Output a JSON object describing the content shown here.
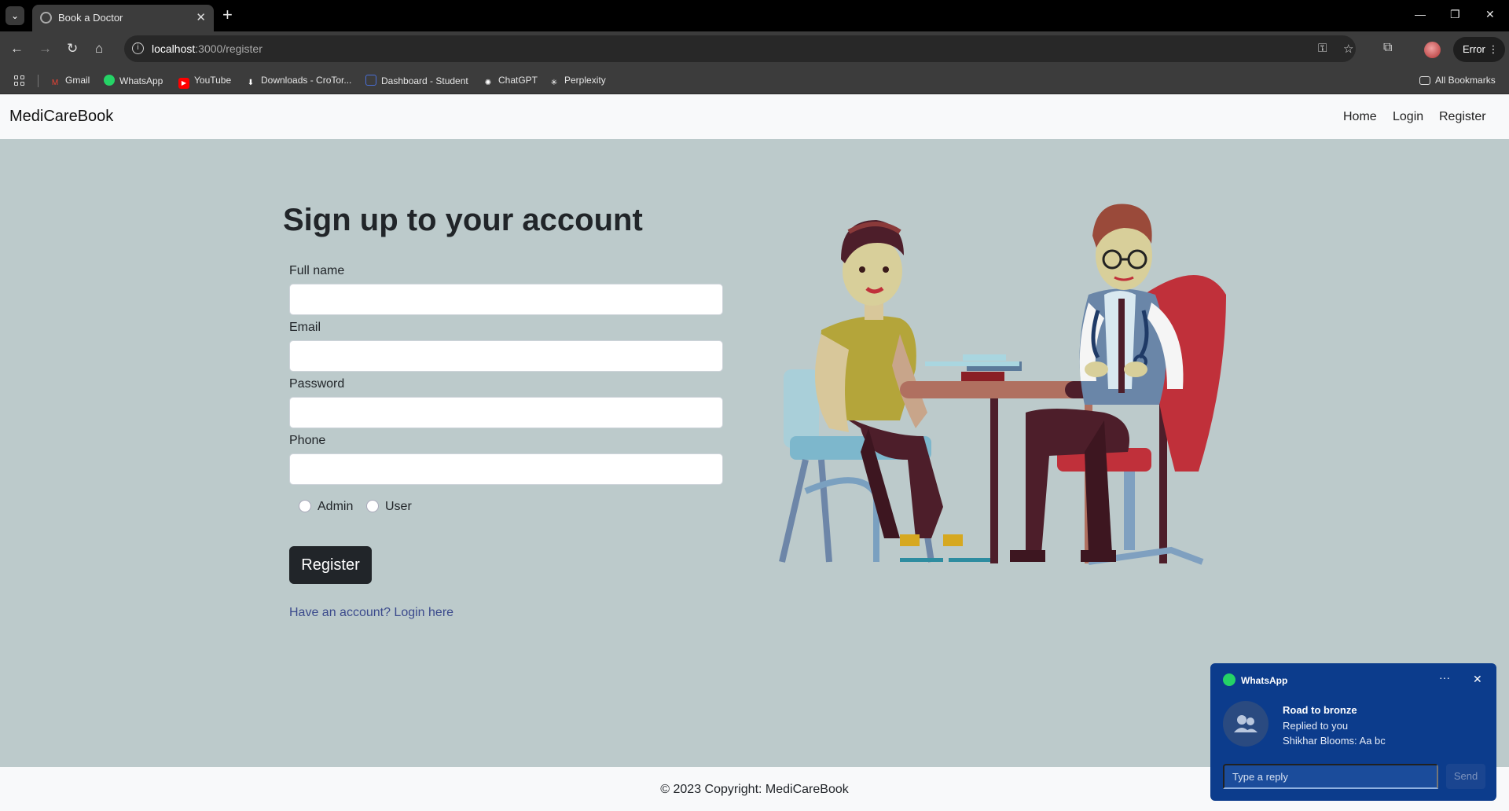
{
  "browser": {
    "tab_title": "Book a Doctor",
    "url_host": "localhost",
    "url_path": ":3000/register",
    "profile_status": "Error",
    "bookmarks": [
      {
        "label": "Gmail",
        "icon": "gmail-icon",
        "color": "#ea4335"
      },
      {
        "label": "WhatsApp",
        "icon": "whatsapp-icon",
        "color": "#25d366"
      },
      {
        "label": "YouTube",
        "icon": "youtube-icon",
        "color": "#ff0000"
      },
      {
        "label": "Downloads - CroTor...",
        "icon": "download-icon",
        "color": "#ffffff"
      },
      {
        "label": "Dashboard - Student",
        "icon": "dashboard-icon",
        "color": "#4a6fd8"
      },
      {
        "label": "ChatGPT",
        "icon": "chatgpt-icon",
        "color": "#ffffff"
      },
      {
        "label": "Perplexity",
        "icon": "perplexity-icon",
        "color": "#ffffff"
      }
    ],
    "all_bookmarks": "All Bookmarks"
  },
  "navbar": {
    "brand": "MediCareBook",
    "links": [
      "Home",
      "Login",
      "Register"
    ]
  },
  "form": {
    "heading": "Sign up to your account",
    "fields": [
      {
        "label": "Full name",
        "value": ""
      },
      {
        "label": "Email",
        "value": ""
      },
      {
        "label": "Password",
        "value": ""
      },
      {
        "label": "Phone",
        "value": ""
      }
    ],
    "roles": [
      "Admin",
      "User"
    ],
    "submit": "Register",
    "login_prompt": "Have an account? Login here"
  },
  "footer": {
    "text": "© 2023 Copyright: MediCareBook"
  },
  "notification": {
    "app": "WhatsApp",
    "sender": "Road to bronze",
    "line1": "Replied to you",
    "line2": "Shikhar Blooms: Aa bc",
    "reply_placeholder": "Type a reply",
    "send_label": "Send"
  },
  "colors": {
    "page_background": "#bccacb",
    "navbar_background": "#f8f9fa",
    "button_dark": "#212529",
    "link": "#3b4a8c",
    "toast_background": "#0c3c8c"
  }
}
